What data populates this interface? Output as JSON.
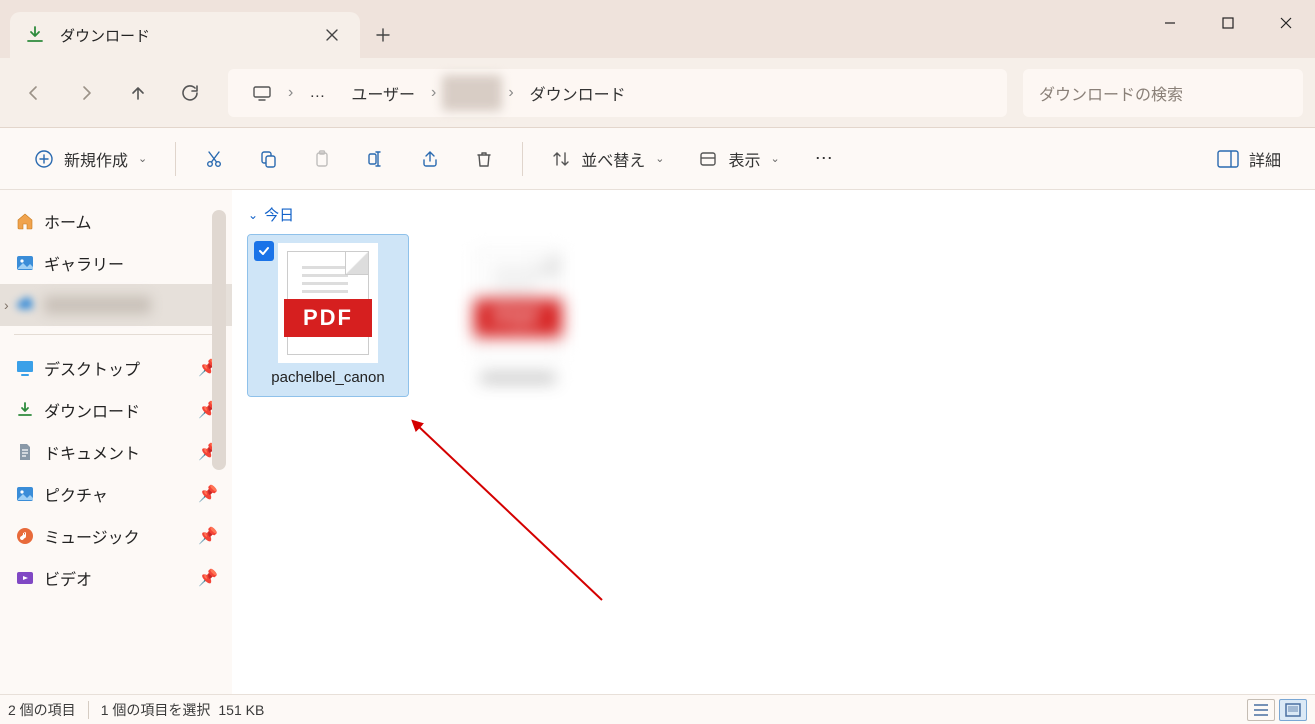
{
  "titlebar": {
    "tab_title": "ダウンロード"
  },
  "breadcrumb": {
    "users": "ユーザー",
    "current": "ダウンロード"
  },
  "search": {
    "placeholder": "ダウンロードの検索"
  },
  "commands": {
    "new": "新規作成",
    "sort": "並べ替え",
    "view": "表示",
    "details": "詳細"
  },
  "sidebar": {
    "home": "ホーム",
    "gallery": "ギャラリー",
    "desktop": "デスクトップ",
    "downloads": "ダウンロード",
    "documents": "ドキュメント",
    "pictures": "ピクチャ",
    "music": "ミュージック",
    "videos": "ビデオ"
  },
  "content": {
    "group_today": "今日",
    "file1_name": "pachelbel_canon",
    "file1_type": "PDF"
  },
  "statusbar": {
    "item_count": "2 個の項目",
    "selection": "1 個の項目を選択",
    "size": "151 KB"
  }
}
